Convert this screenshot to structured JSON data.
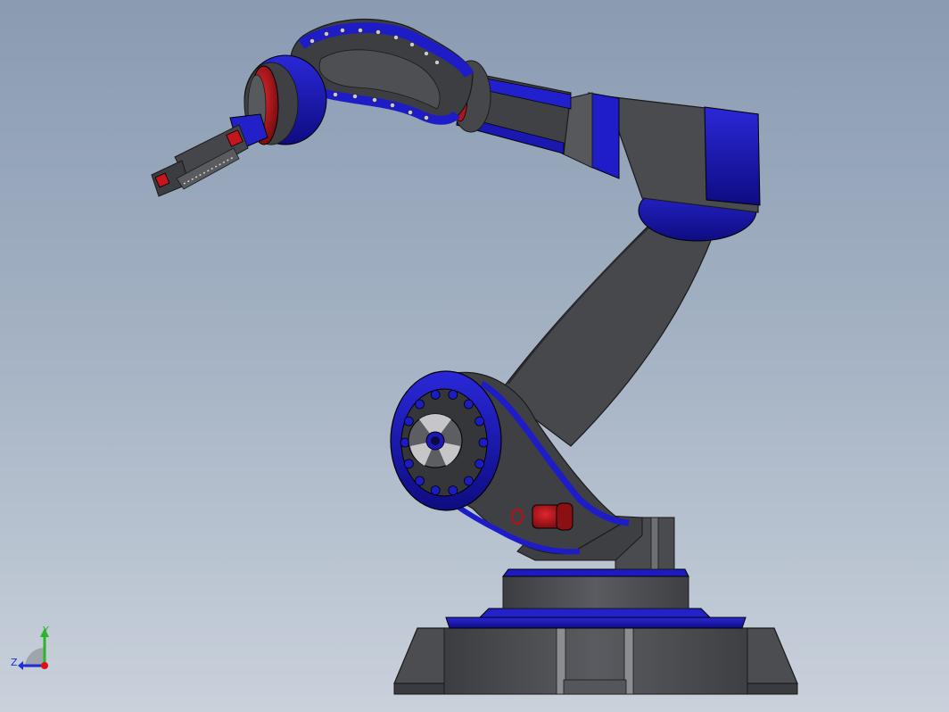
{
  "viewport": {
    "background_top": "#8a9bb2",
    "background_bottom": "#c9d1db"
  },
  "model": {
    "part_colors": {
      "dark_gray": "#4a4b4f",
      "mid_gray": "#5e5f63",
      "blue": "#1a18b8",
      "dark_blue": "#0d0c6e",
      "red": "#c4161c",
      "dark_red": "#7a0d10",
      "silver": "#b9b9bd"
    }
  },
  "triad": {
    "y_label": "Y",
    "z_label": "Z",
    "y_color": "#2bb52b",
    "z_color": "#1f2fd6",
    "x_color": "#e01010"
  }
}
